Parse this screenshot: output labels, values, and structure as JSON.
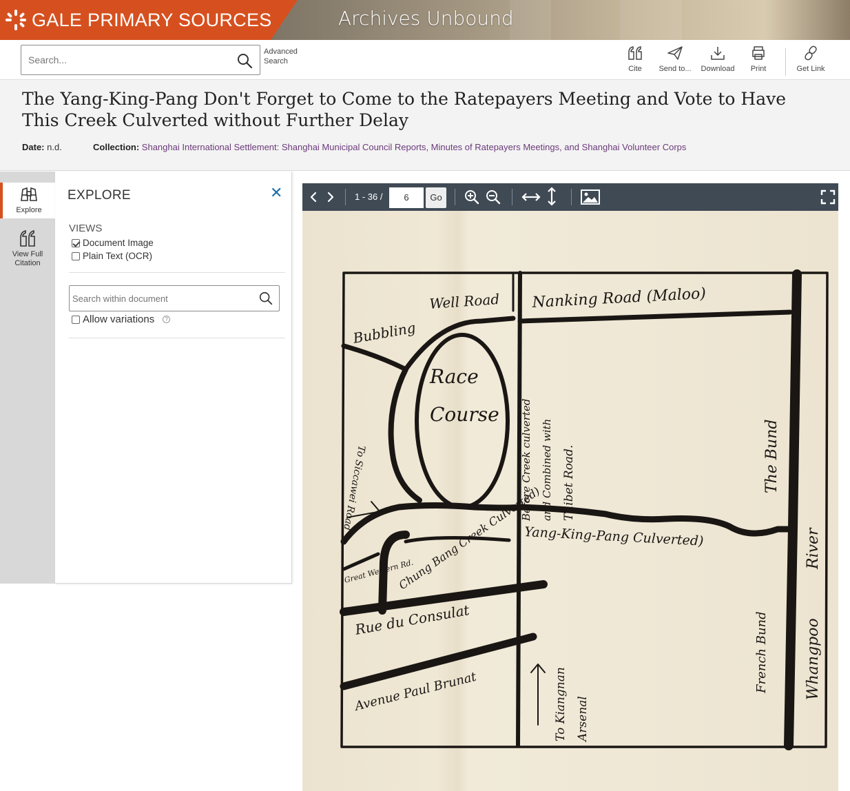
{
  "banner": {
    "brand": "GALE PRIMARY SOURCES",
    "product": "Archives Unbound",
    "brand_color": "#d6501f"
  },
  "toolbar": {
    "search_placeholder": "Search...",
    "advanced_search": "Advanced Search",
    "tools": [
      {
        "label": "Cite",
        "icon": "quote-icon"
      },
      {
        "label": "Send to...",
        "icon": "send-icon"
      },
      {
        "label": "Download",
        "icon": "download-icon"
      },
      {
        "label": "Print",
        "icon": "print-icon"
      },
      {
        "label": "Get Link",
        "icon": "link-icon"
      }
    ]
  },
  "document": {
    "title": "The Yang-King-Pang Don't Forget to Come to the Ratepayers Meeting and Vote to Have This Creek Culverted without Further Delay",
    "date_label": "Date:",
    "date": "n.d.",
    "collection_label": "Collection:",
    "collection": "Shanghai International Settlement: Shanghai Municipal Council Reports, Minutes of Ratepayers Meetings, and Shanghai Volunteer Corps"
  },
  "rail": {
    "items": [
      {
        "label": "Explore",
        "icon": "binoculars-icon",
        "active": true
      },
      {
        "label": "View Full Citation",
        "icon": "quote-icon",
        "active": false
      }
    ]
  },
  "explore": {
    "title": "EXPLORE",
    "views_label": "VIEWS",
    "views": [
      {
        "label": "Document Image",
        "checked": true
      },
      {
        "label": "Plain Text (OCR)",
        "checked": false
      }
    ],
    "search_placeholder": "Search within document",
    "allow_variations": "Allow variations",
    "help": "?"
  },
  "viewer": {
    "page_range": "1 - 36 /",
    "current_page": "6",
    "go_label": "Go"
  },
  "map_labels": {
    "well_road": "Well Road",
    "nanking_road": "Nanking Road (Maloo)",
    "bubbling": "Bubbling",
    "race": "Race",
    "course": "Course",
    "before_creek": "Before Creek culverted",
    "combined": "and Combined with",
    "thibet_road": "Thibet Road.",
    "the_bund": "The Bund",
    "river": "River",
    "whangpoo": "Whangpoo",
    "to_siccawei": "To Siccawei Road",
    "yang_king_pang": "Yang-King-Pang Culverted)",
    "great_western": "Great Western Rd.",
    "chung_bang": "Chung Bang Creek Culverted)",
    "rue_du_consulat": "Rue du Consulat",
    "avenue_paul_brunat": "Avenue Paul Brunat",
    "french_bund": "French Bund",
    "to_kiangnan": "To Kiangnan",
    "arsenal": "Arsenal"
  }
}
